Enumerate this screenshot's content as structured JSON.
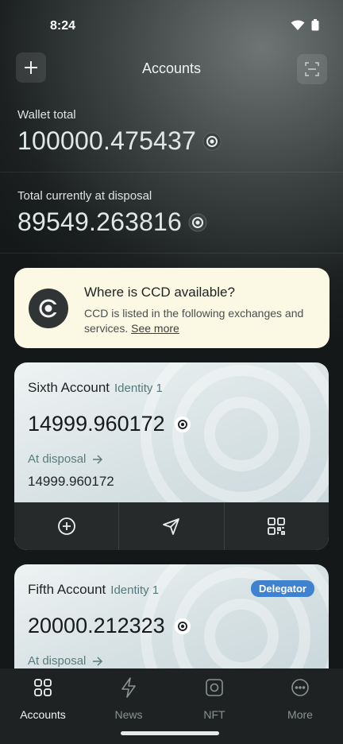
{
  "status": {
    "time": "8:24"
  },
  "header": {
    "title": "Accounts"
  },
  "wallet_total": {
    "label": "Wallet total",
    "value": "100000.475437"
  },
  "disposal_total": {
    "label": "Total currently at disposal",
    "value": "89549.263816"
  },
  "info_card": {
    "title": "Where is CCD available?",
    "text": "CCD is listed in the following exchanges and services.",
    "link": "See more"
  },
  "accounts": [
    {
      "name": "Sixth Account",
      "identity": "Identity 1",
      "balance": "14999.960172",
      "disposal_label": "At disposal",
      "disposal_value": "14999.960172"
    },
    {
      "name": "Fifth Account",
      "identity": "Identity 1",
      "badge": "Delegator",
      "balance": "20000.212323",
      "disposal_label": "At disposal"
    }
  ],
  "nav": {
    "items": [
      {
        "label": "Accounts",
        "icon": "grid-icon",
        "active": true
      },
      {
        "label": "News",
        "icon": "lightning-icon",
        "active": false
      },
      {
        "label": "NFT",
        "icon": "nft-icon",
        "active": false
      },
      {
        "label": "More",
        "icon": "more-icon",
        "active": false
      }
    ]
  },
  "colors": {
    "info_card_bg": "#fbf8e3",
    "delegator_badge": "#3f82cf",
    "card_actions_bg": "#262a2a",
    "nav_bg": "#1f2222"
  }
}
